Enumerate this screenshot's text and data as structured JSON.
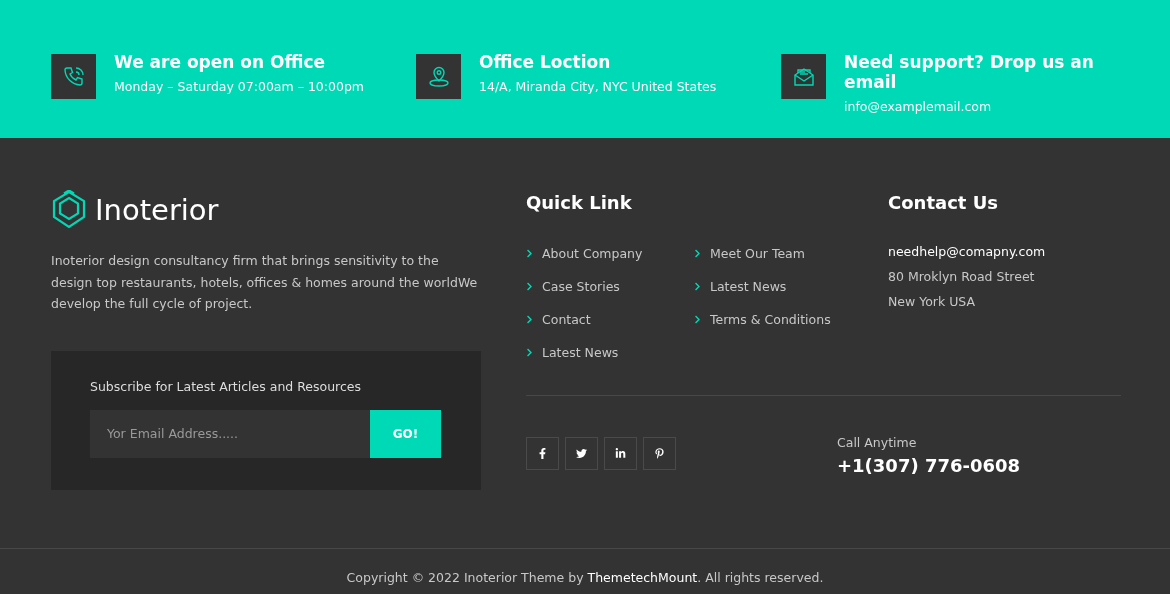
{
  "info_bar": [
    {
      "kind": "phone",
      "title": "We are open on Office",
      "text": "Monday – Saturday 07:00am – 10:00pm"
    },
    {
      "kind": "location",
      "title": "Office Loction",
      "text": "14/A, Miranda City, NYC United States"
    },
    {
      "kind": "email",
      "title": "Need support? Drop us an email",
      "text": "info@examplemail.com"
    }
  ],
  "brand": {
    "name": "Inoterior",
    "description": "Inoterior design consultancy firm that brings sensitivity to the design top restaurants, hotels, offices & homes around the worldWe develop the full cycle of project."
  },
  "subscribe": {
    "label": "Subscribe for Latest Articles and Resources",
    "placeholder": "Yor Email Address.....",
    "button": "GO!"
  },
  "quick_links": {
    "title": "Quick Link",
    "columns": [
      [
        "About Company",
        "Case Stories",
        "Contact",
        "Latest News"
      ],
      [
        "Meet Our Team",
        "Latest News",
        "Terms & Conditions"
      ]
    ]
  },
  "contact": {
    "title": "Contact Us",
    "email": "needhelp@comapny.com",
    "lines": [
      "80 Mroklyn Road Street",
      "New York USA"
    ]
  },
  "social": [
    {
      "kind": "facebook"
    },
    {
      "kind": "twitter"
    },
    {
      "kind": "linkedin"
    },
    {
      "kind": "pinterest"
    }
  ],
  "call": {
    "label": "Call Anytime",
    "phone": "+1(307) 776-0608"
  },
  "copyright": "Copyright © 2022 Inoterior Theme by **ThemetechMount**. All rights reserved."
}
